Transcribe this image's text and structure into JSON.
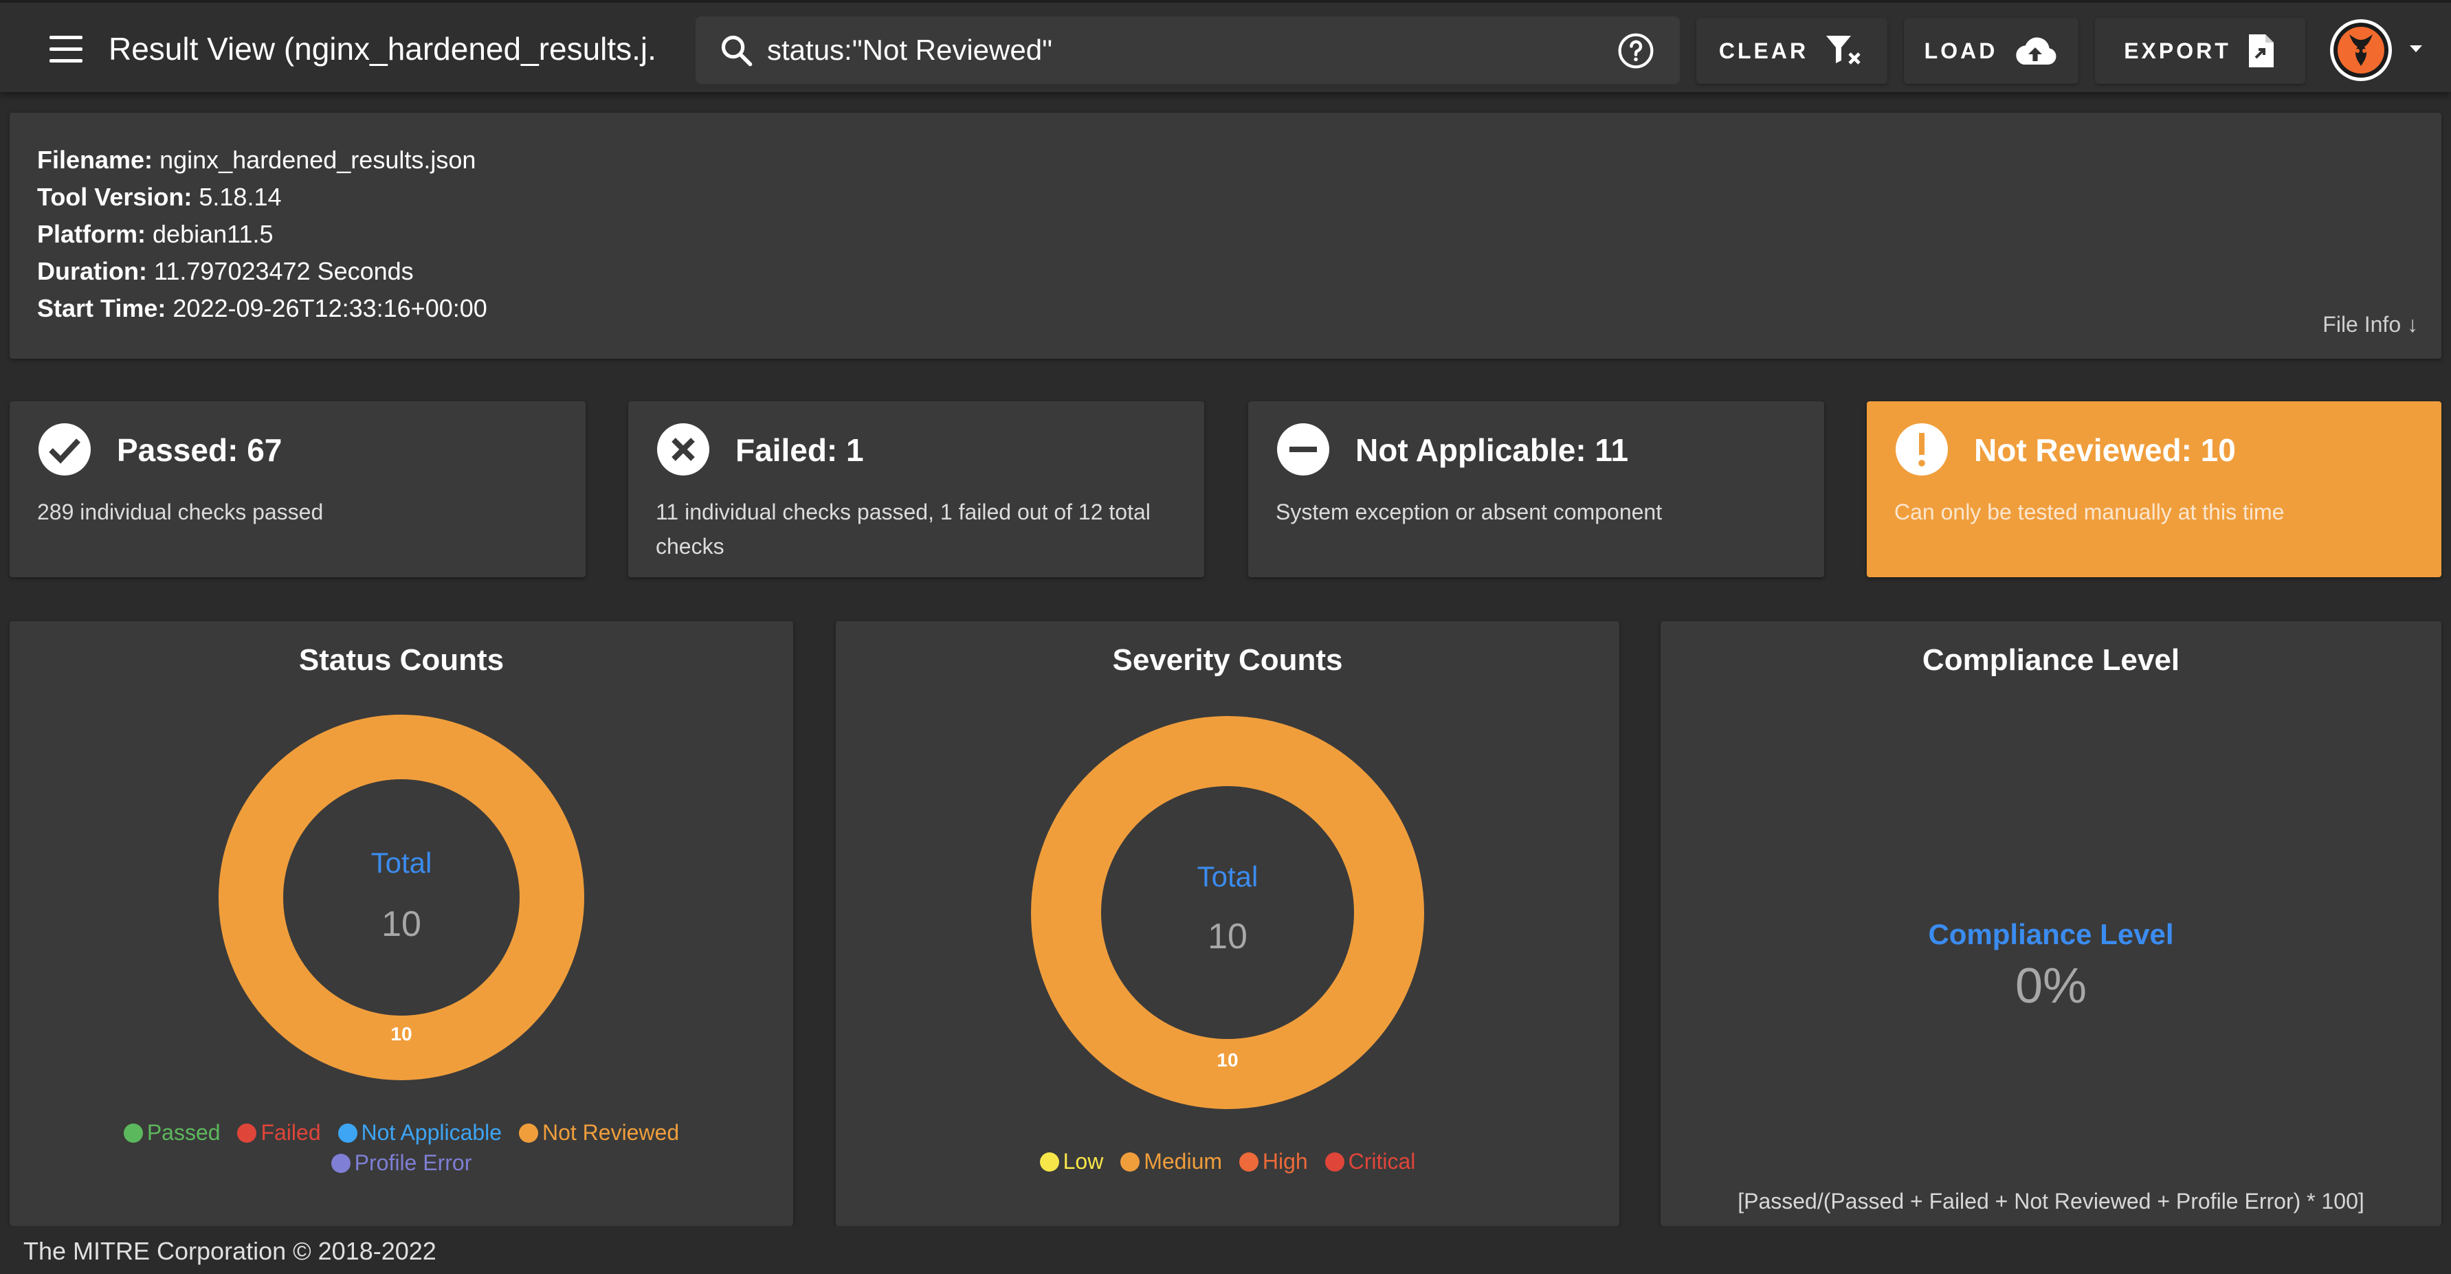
{
  "header": {
    "title": "Result View (nginx_hardened_results.j...",
    "search_value": "status:\"Not Reviewed\"",
    "clear_label": "CLEAR",
    "load_label": "LOAD",
    "export_label": "EXPORT"
  },
  "file_info": {
    "filename_label": "Filename:",
    "filename": "nginx_hardened_results.json",
    "tool_version_label": "Tool Version:",
    "tool_version": "5.18.14",
    "platform_label": "Platform:",
    "platform": "debian11.5",
    "duration_label": "Duration:",
    "duration": "11.797023472 Seconds",
    "start_time_label": "Start Time:",
    "start_time": "2022-09-26T12:33:16+00:00",
    "link": "File Info ↓"
  },
  "cards": [
    {
      "title": "Passed: 67",
      "desc": "289 individual checks passed",
      "icon": "check-icon"
    },
    {
      "title": "Failed: 1",
      "desc": "11 individual checks passed, 1 failed out of 12 total checks",
      "icon": "close-icon"
    },
    {
      "title": "Not Applicable: 11",
      "desc": "System exception or absent component",
      "icon": "minus-icon"
    },
    {
      "title": "Not Reviewed: 10",
      "desc": "Can only be tested manually at this time",
      "icon": "exclamation-icon"
    }
  ],
  "status_counts": {
    "title": "Status Counts",
    "center_label": "Total",
    "center_value": "10",
    "segment_label": "10",
    "legend": [
      {
        "label": "Passed",
        "color": "#5cb85c"
      },
      {
        "label": "Failed",
        "color": "#e0453a"
      },
      {
        "label": "Not Applicable",
        "color": "#3da5f4"
      },
      {
        "label": "Not Reviewed",
        "color": "#f09e3c"
      },
      {
        "label": "Profile Error",
        "color": "#7f7fd5"
      }
    ]
  },
  "severity_counts": {
    "title": "Severity Counts",
    "center_label": "Total",
    "center_value": "10",
    "segment_label": "10",
    "legend": [
      {
        "label": "Low",
        "color": "#f7e64a"
      },
      {
        "label": "Medium",
        "color": "#f09e3c"
      },
      {
        "label": "High",
        "color": "#ee6a3a"
      },
      {
        "label": "Critical",
        "color": "#e0453a"
      }
    ]
  },
  "compliance": {
    "title": "Compliance Level",
    "label": "Compliance Level",
    "value": "0%",
    "formula": "[Passed/(Passed + Failed + Not Reviewed + Profile Error) * 100]"
  },
  "chart_data": [
    {
      "type": "pie",
      "title": "Status Counts",
      "categories": [
        "Passed",
        "Failed",
        "Not Applicable",
        "Not Reviewed",
        "Profile Error"
      ],
      "values": [
        0,
        0,
        0,
        10,
        0
      ]
    },
    {
      "type": "pie",
      "title": "Severity Counts",
      "categories": [
        "Low",
        "Medium",
        "High",
        "Critical"
      ],
      "values": [
        0,
        10,
        0,
        0
      ]
    }
  ],
  "footer": {
    "text": "The MITRE Corporation © 2018-2022"
  }
}
